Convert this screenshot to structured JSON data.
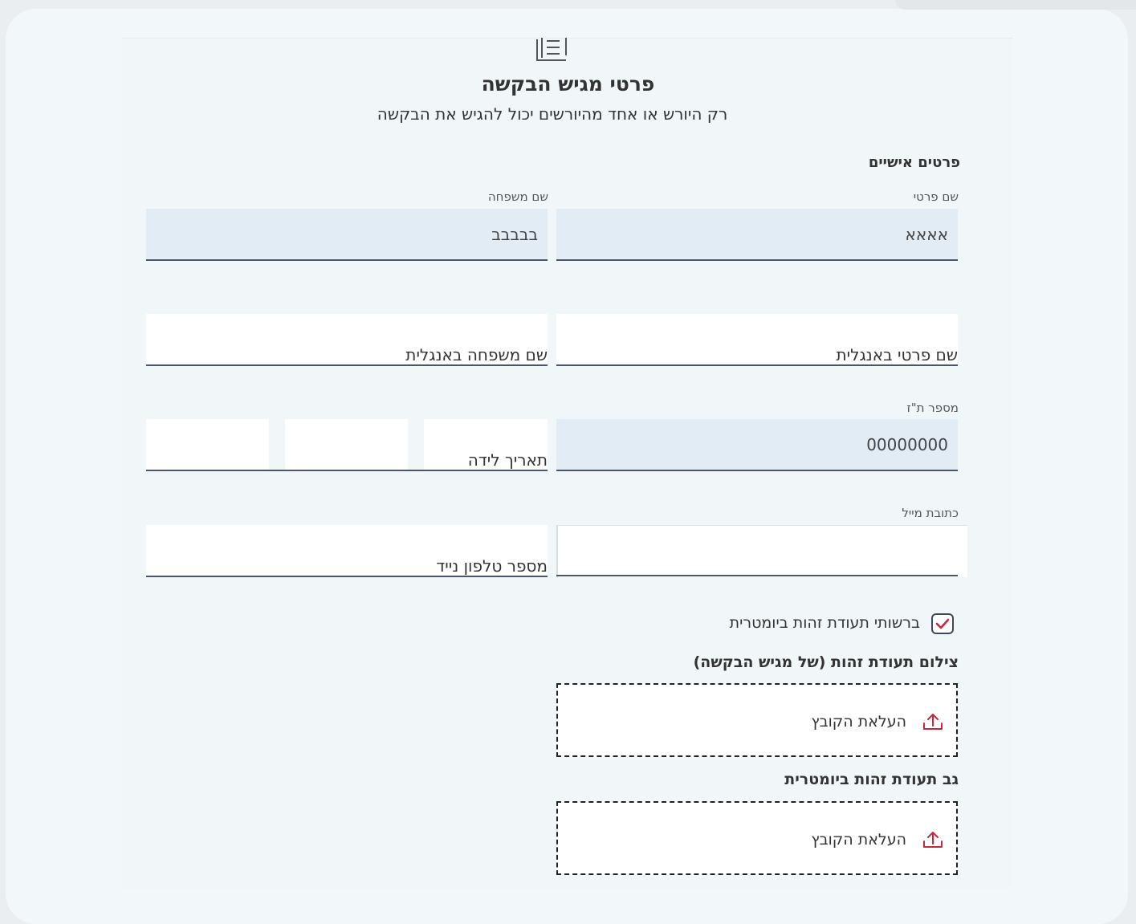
{
  "header": {
    "icon": "document-list-icon",
    "title": "פרטי מגיש הבקשה",
    "subtitle": "רק היורש או אחד מהיורשים יכול להגיש את הבקשה"
  },
  "personal": {
    "section_title": "פרטים אישיים",
    "first_name": {
      "label": "שם פרטי",
      "value": "אאאא"
    },
    "last_name": {
      "label": "שם משפחה",
      "value": "בבבבב"
    },
    "first_name_en": {
      "label": "שם פרטי באנגלית",
      "value": ""
    },
    "last_name_en": {
      "label": "שם משפחה באנגלית",
      "value": ""
    },
    "id_number": {
      "label": "מספר ת\"ז",
      "value": "00000000"
    },
    "birth_date": {
      "label": "תאריך לידה",
      "day": "",
      "month": "",
      "year": ""
    },
    "email": {
      "label": "כתובת מייל",
      "value": ""
    },
    "mobile": {
      "label": "מספר טלפון נייד",
      "value": ""
    }
  },
  "biometric": {
    "checked": true,
    "label": "ברשותי תעודת זהות ביומטרית"
  },
  "uploads": {
    "id_photo_title": "צילום תעודת זהות (של מגיש הבקשה)",
    "id_back_title": "גב תעודת זהות ביומטרית",
    "upload_label": "העלאת הקובץ",
    "upload_icon": "upload-icon",
    "accent_color": "#c8283c"
  }
}
